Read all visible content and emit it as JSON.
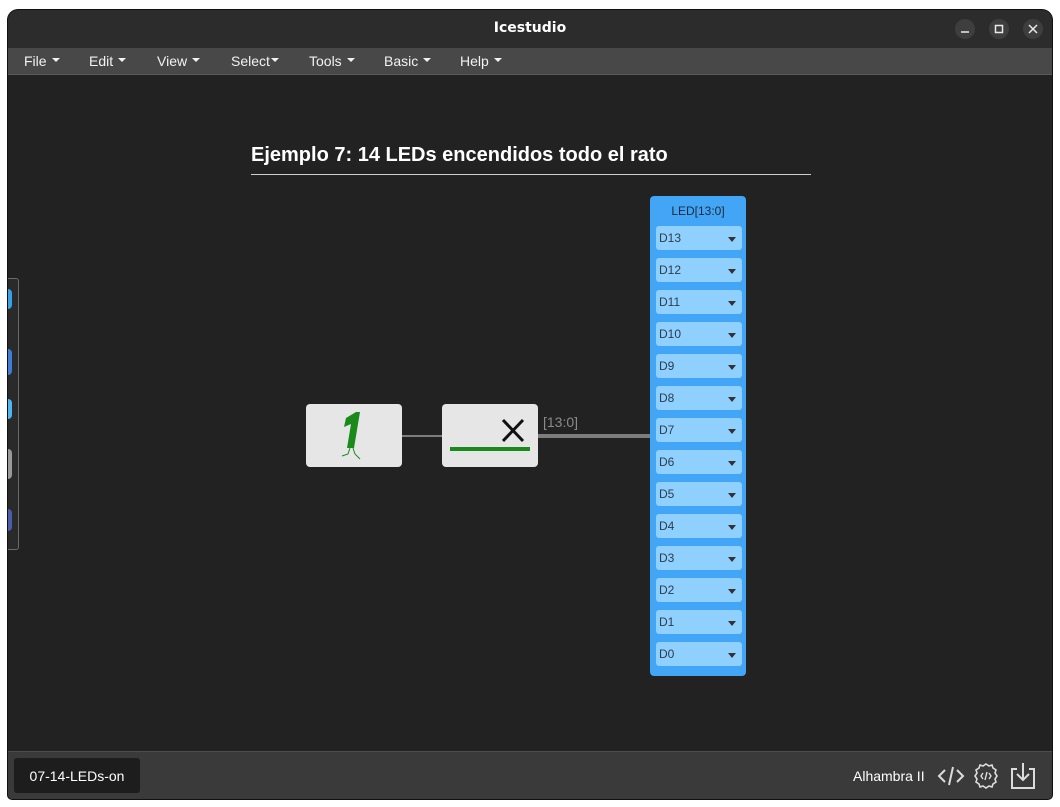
{
  "window": {
    "title": "Icestudio"
  },
  "menu": [
    {
      "label": "File"
    },
    {
      "label": "Edit"
    },
    {
      "label": "View"
    },
    {
      "label": "Select"
    },
    {
      "label": "Tools"
    },
    {
      "label": "Basic"
    },
    {
      "label": "Help"
    }
  ],
  "canvas": {
    "heading": "Ejemplo 7: 14 LEDs encendidos todo el rato",
    "bus_label": "[13:0]",
    "led_block": {
      "title": "LED[13:0]",
      "pins": [
        "D13",
        "D12",
        "D11",
        "D10",
        "D9",
        "D8",
        "D7",
        "D6",
        "D5",
        "D4",
        "D3",
        "D2",
        "D1",
        "D0"
      ]
    }
  },
  "colors": {
    "accent_blue": "#42a5f5",
    "pin_blue": "#8fd0ff",
    "constant_green": "#1a8a1a",
    "canvas_bg": "#222222"
  },
  "bottom": {
    "tab": "07-14-LEDs-on",
    "board": "Alhambra II"
  }
}
